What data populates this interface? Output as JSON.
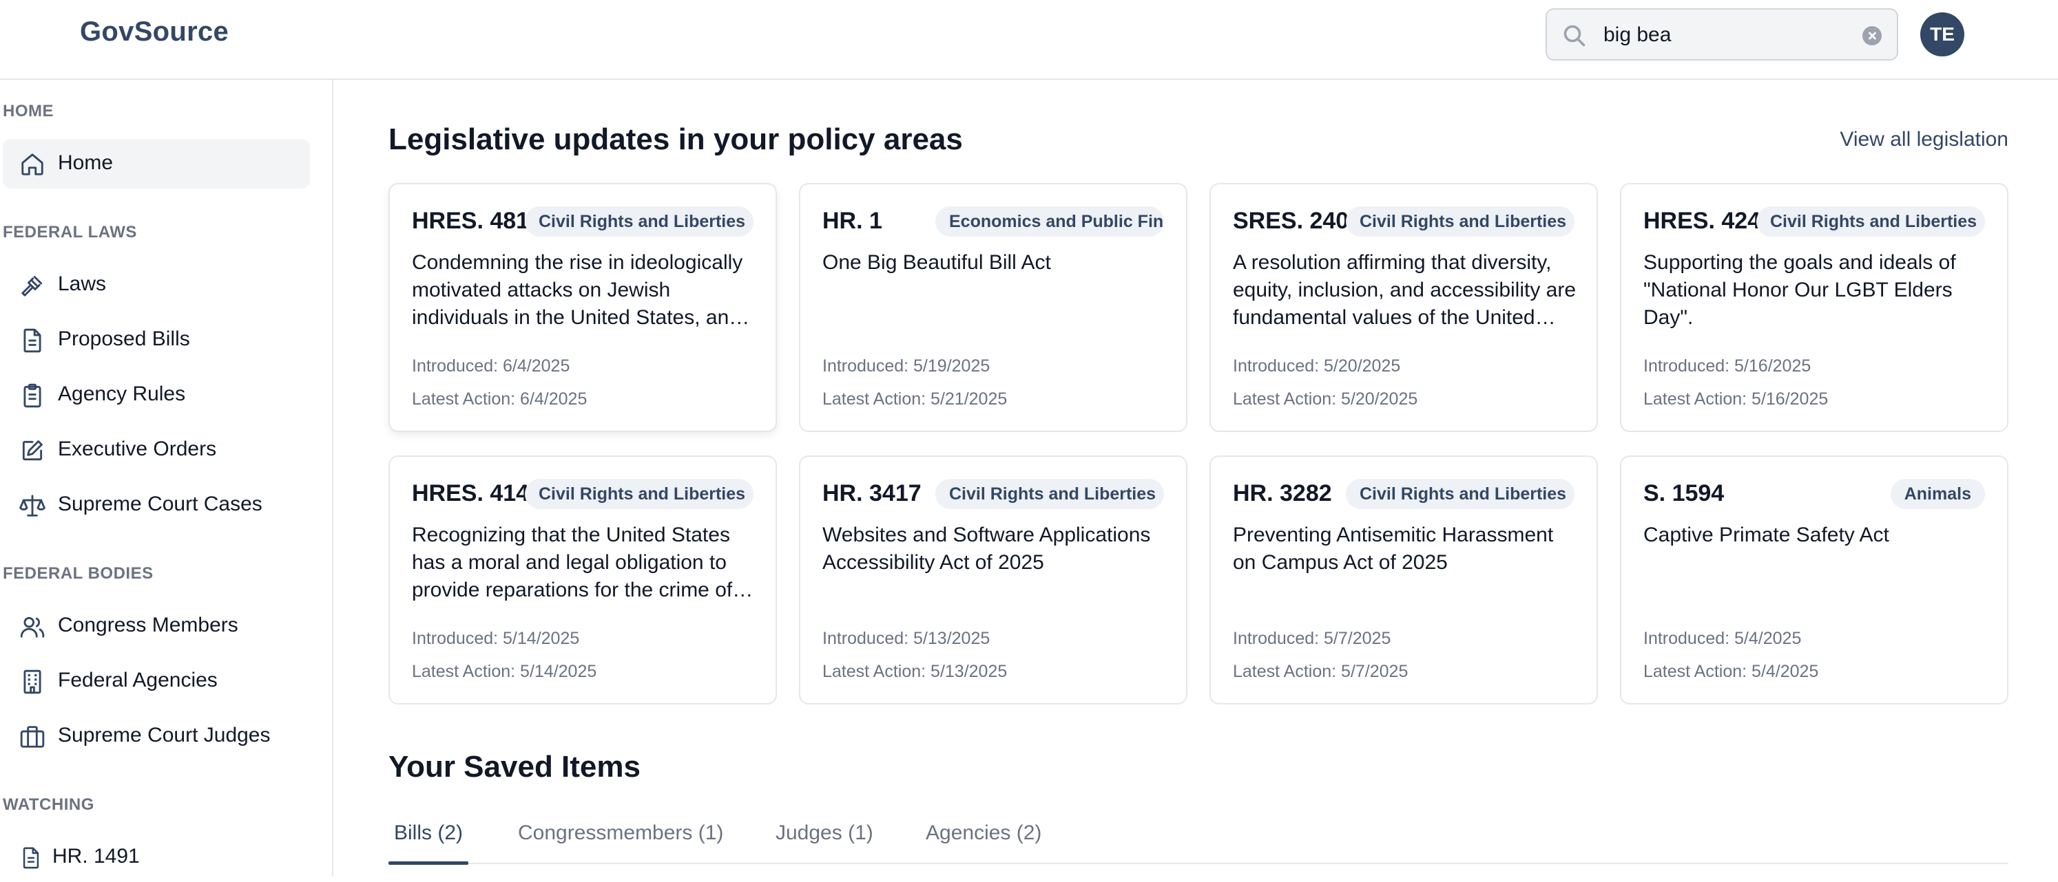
{
  "app": {
    "brand": "GovSource"
  },
  "header": {
    "search_value": "big bea",
    "avatar_initials": "TE"
  },
  "sidebar": {
    "sections": {
      "home": "HOME",
      "federal_laws": "FEDERAL LAWS",
      "federal_bodies": "FEDERAL BODIES",
      "watching": "WATCHING"
    },
    "items": [
      {
        "label": "Home",
        "icon": "home-icon",
        "active": true
      },
      {
        "label": "Laws",
        "icon": "gavel-icon"
      },
      {
        "label": "Proposed Bills",
        "icon": "document-icon"
      },
      {
        "label": "Agency Rules",
        "icon": "clipboard-icon"
      },
      {
        "label": "Executive Orders",
        "icon": "edit-icon"
      },
      {
        "label": "Supreme Court Cases",
        "icon": "scale-icon"
      },
      {
        "label": "Congress Members",
        "icon": "users-icon"
      },
      {
        "label": "Federal Agencies",
        "icon": "building-icon"
      },
      {
        "label": "Supreme Court Judges",
        "icon": "briefcase-icon"
      }
    ],
    "watching": [
      {
        "label": "HR. 1491",
        "icon": "document-icon"
      }
    ]
  },
  "main": {
    "title": "Legislative updates in your policy areas",
    "view_all": "View all legislation",
    "cards": [
      {
        "id": "HRES. 481",
        "tag": "Civil Rights and Liberties",
        "title": "Condemning the rise in ideologically motivated attacks on Jewish individuals in the United States, and for other purposes.",
        "introduced": "Introduced: 6/4/2025",
        "latest": "Latest Action: 6/4/2025"
      },
      {
        "id": "HR. 1",
        "tag": "Economics and Public Finance",
        "title": "One Big Beautiful Bill Act",
        "introduced": "Introduced: 5/19/2025",
        "latest": "Latest Action: 5/21/2025"
      },
      {
        "id": "SRES. 240",
        "tag": "Civil Rights and Liberties",
        "title": "A resolution affirming that diversity, equity, inclusion, and accessibility are fundamental values of the United States.",
        "introduced": "Introduced: 5/20/2025",
        "latest": "Latest Action: 5/20/2025"
      },
      {
        "id": "HRES. 424",
        "tag": "Civil Rights and Liberties",
        "title": "Supporting the goals and ideals of \"National Honor Our LGBT Elders Day\".",
        "introduced": "Introduced: 5/16/2025",
        "latest": "Latest Action: 5/16/2025"
      },
      {
        "id": "HRES. 414",
        "tag": "Civil Rights and Liberties",
        "title": "Recognizing that the United States has a moral and legal obligation to provide reparations for the crime of enslavement.",
        "introduced": "Introduced: 5/14/2025",
        "latest": "Latest Action: 5/14/2025"
      },
      {
        "id": "HR. 3417",
        "tag": "Civil Rights and Liberties",
        "title": "Websites and Software Applications Accessibility Act of 2025",
        "introduced": "Introduced: 5/13/2025",
        "latest": "Latest Action: 5/13/2025"
      },
      {
        "id": "HR. 3282",
        "tag": "Civil Rights and Liberties",
        "title": "Preventing Antisemitic Harassment on Campus Act of 2025",
        "introduced": "Introduced: 5/7/2025",
        "latest": "Latest Action: 5/7/2025"
      },
      {
        "id": "S. 1594",
        "tag": "Animals",
        "title": "Captive Primate Safety Act",
        "introduced": "Introduced: 5/4/2025",
        "latest": "Latest Action: 5/4/2025"
      }
    ]
  },
  "saved": {
    "title": "Your Saved Items",
    "tabs": [
      {
        "label": "Bills (2)",
        "active": true
      },
      {
        "label": "Congressmembers (1)"
      },
      {
        "label": "Judges (1)"
      },
      {
        "label": "Agencies (2)"
      }
    ]
  },
  "colors": {
    "brand": "#334766",
    "tag_bg": "#eef1f5",
    "muted_text": "#6b7280",
    "border": "#e5e7eb"
  }
}
